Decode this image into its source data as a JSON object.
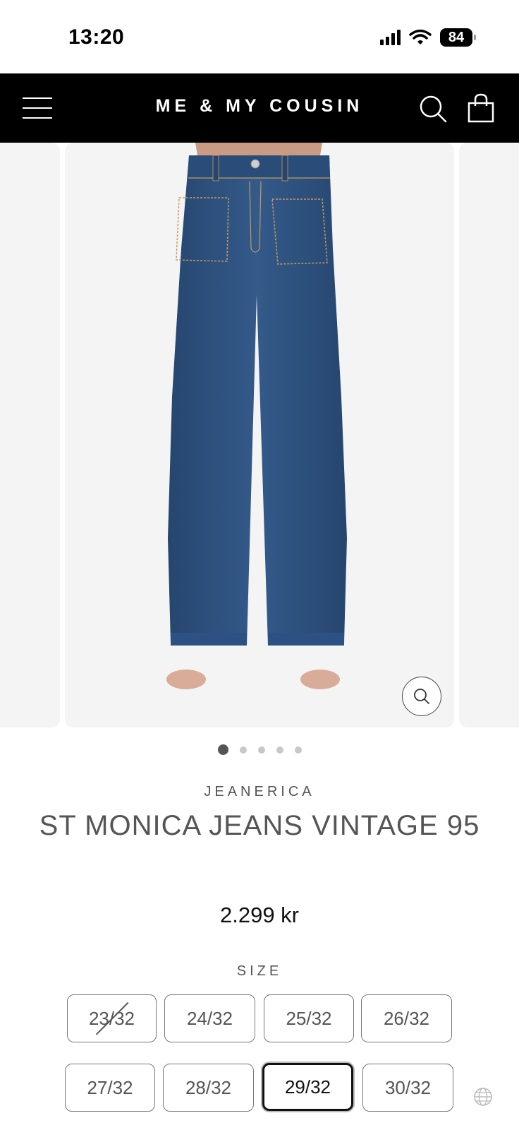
{
  "status_bar": {
    "time": "13:20",
    "battery": "84",
    "icons": [
      "signal-icon",
      "wifi-icon",
      "battery-icon"
    ]
  },
  "header": {
    "brand": "ME & MY COUSIN",
    "icons": [
      "menu-icon",
      "search-icon",
      "cart-icon"
    ],
    "background": "#000000"
  },
  "gallery": {
    "slide_count": 5,
    "active_index": 0,
    "zoom_icon": "zoom-icon"
  },
  "product": {
    "vendor": "JEANERICA",
    "title": "ST MONICA JEANS VINTAGE 95",
    "price": "2.299 kr"
  },
  "size": {
    "label": "SIZE",
    "options": [
      {
        "label": "23/32",
        "available": false,
        "selected": false
      },
      {
        "label": "24/32",
        "available": true,
        "selected": false
      },
      {
        "label": "25/32",
        "available": true,
        "selected": false
      },
      {
        "label": "26/32",
        "available": true,
        "selected": false
      },
      {
        "label": "27/32",
        "available": true,
        "selected": false
      },
      {
        "label": "28/32",
        "available": true,
        "selected": false
      },
      {
        "label": "29/32",
        "available": true,
        "selected": true
      },
      {
        "label": "30/32",
        "available": true,
        "selected": false
      }
    ]
  },
  "colors": {
    "denim": "#2e4f7c",
    "accent": "#000000",
    "text_muted": "#555555"
  }
}
